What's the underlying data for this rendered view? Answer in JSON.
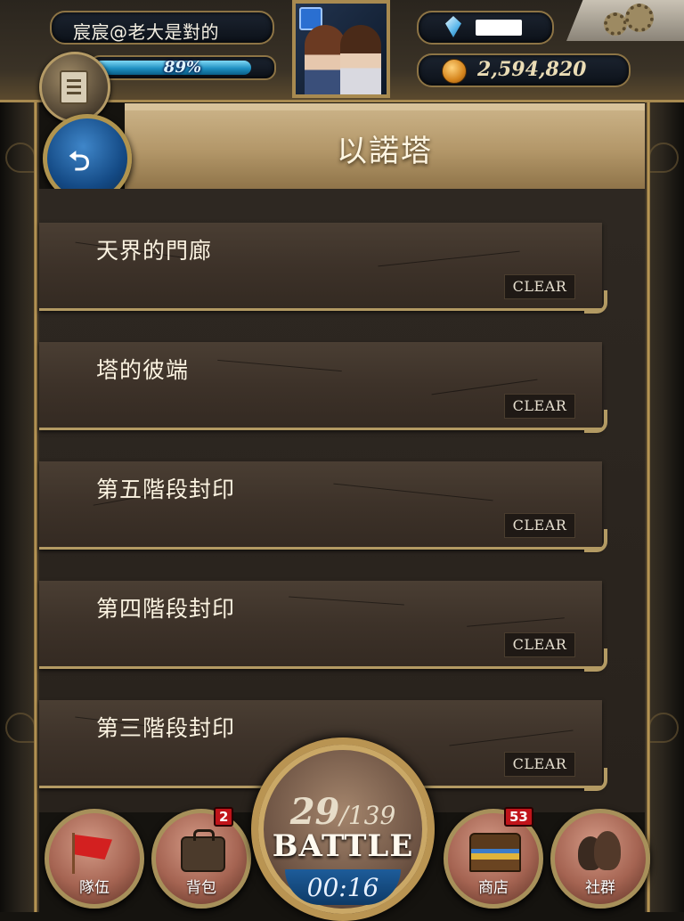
{
  "header": {
    "player_name": "宸宸@老大是對的",
    "exp_percent": 89,
    "exp_label": "89%",
    "gems": "",
    "gold": "2,594,820"
  },
  "page": {
    "title": "以諾塔"
  },
  "stages": [
    {
      "name": "天界的門廊",
      "status": "CLEAR"
    },
    {
      "name": "塔的彼端",
      "status": "CLEAR"
    },
    {
      "name": "第五階段封印",
      "status": "CLEAR"
    },
    {
      "name": "第四階段封印",
      "status": "CLEAR"
    },
    {
      "name": "第三階段封印",
      "status": "CLEAR"
    }
  ],
  "bottom_nav": {
    "team_label": "隊伍",
    "bag_label": "背包",
    "bag_badge": "2",
    "shop_label": "商店",
    "shop_badge": "53",
    "social_label": "社群"
  },
  "battle": {
    "stamina_current": "29",
    "stamina_max": "/139",
    "label": "BATTLE",
    "timer": "00:16"
  },
  "colors": {
    "accent_gold": "#b39a63",
    "exp_bar": "#1f90c2",
    "badge_red": "#c0141a"
  }
}
